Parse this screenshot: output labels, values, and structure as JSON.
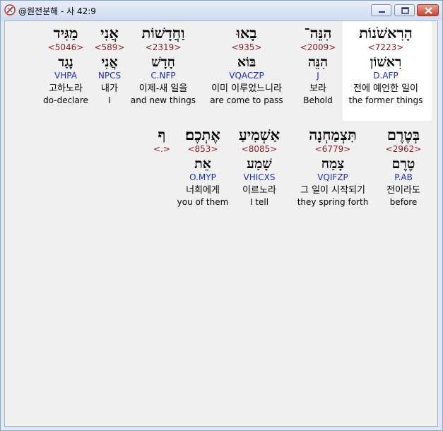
{
  "window": {
    "title": "@원전분해 - 사 42:9"
  },
  "rows": [
    {
      "words": [
        {
          "hebrew": "הָרִאשֹׁנוֹת",
          "strong": "<7223>",
          "root": "רִאשׁוֹן",
          "morph": "D.AFP",
          "korean": "전에 예언한 일이",
          "english": "the former things"
        },
        {
          "hebrew": "הִנֵּה־",
          "strong": "<2009>",
          "root": "הִנֵּה",
          "morph": "J",
          "korean": "보라",
          "english": "Behold"
        },
        {
          "hebrew": "בָאוּ",
          "strong": "<935>",
          "root": "בּוֹא",
          "morph": "VQACZP",
          "korean": "이미 이루었느니라",
          "english": "are come to pass"
        },
        {
          "hebrew": "וַחֲדָשׁוֹת",
          "strong": "<2319>",
          "root": "חָדָשׁ",
          "morph": "C.NFP",
          "korean": "이제-새 일을",
          "english": "and new things"
        },
        {
          "hebrew": "אֲנִי",
          "strong": "<589>",
          "root": "אֲנִי",
          "morph": "NPCS",
          "korean": "내가",
          "english": "I"
        },
        {
          "hebrew": "מַגִּיד",
          "strong": "<5046>",
          "root": "נָגַד",
          "morph": "VHPA",
          "korean": "고하노라",
          "english": "do-declare"
        }
      ]
    },
    {
      "words": [
        {
          "hebrew": "בְּטֶרֶם",
          "strong": "<2962>",
          "root": "טֶרֶם",
          "morph": "P.AB",
          "korean": "전이라도",
          "english": "before"
        },
        {
          "hebrew": "תִּצְמַחְנָה",
          "strong": "<6779>",
          "root": "צָמַח",
          "morph": "VQIFZP",
          "korean": "그 일이 시작되기",
          "english": "they spring forth"
        },
        {
          "hebrew": "אַשְׁמִיעַ",
          "strong": "<8085>",
          "root": "שָׁמַע",
          "morph": "VHICXS",
          "korean": "이르노라",
          "english": "I tell"
        },
        {
          "hebrew": "אֶתְכֶם׃",
          "strong": "<853>",
          "root": "אֵת",
          "morph": "O.MYP",
          "korean": "너희에게",
          "english": "you of them"
        },
        {
          "hebrew": "ף",
          "strong": "<.>",
          "root": "",
          "morph": "",
          "korean": "",
          "english": ""
        }
      ]
    }
  ]
}
